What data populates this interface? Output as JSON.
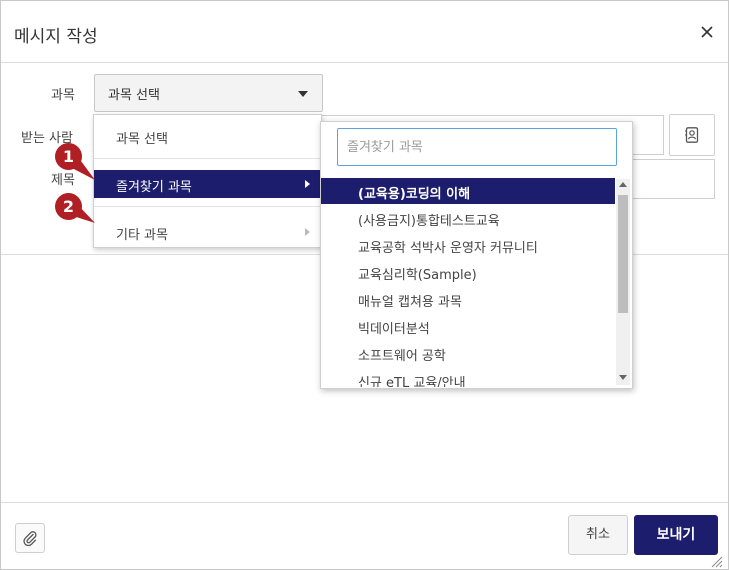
{
  "dialog": {
    "title": "메시지 작성"
  },
  "form": {
    "course_label": "과목",
    "recipient_label": "받는 사람",
    "subject_label": "제목",
    "course_select_value": "과목 선택"
  },
  "menu": {
    "items": [
      {
        "label": "과목 선택"
      },
      {
        "label": "즐겨찾기 과목"
      },
      {
        "label": "기타 과목"
      }
    ]
  },
  "submenu": {
    "search_placeholder": "즐겨찾기 과목",
    "items": [
      {
        "label": "(교육용)코딩의 이해"
      },
      {
        "label": "(사용금지)통합테스트교육"
      },
      {
        "label": "교육공학 석박사 운영자 커뮤니티"
      },
      {
        "label": "교육심리학(Sample)"
      },
      {
        "label": "매뉴얼 캡쳐용 과목"
      },
      {
        "label": "빅데이터분석"
      },
      {
        "label": "소프트웨어 공학"
      },
      {
        "label": "신규 eTL 교육/안내"
      }
    ]
  },
  "callouts": [
    {
      "number": "1"
    },
    {
      "number": "2"
    }
  ],
  "footer": {
    "cancel_label": "취소",
    "send_label": "보내기"
  },
  "colors": {
    "accent": "#1d1d6e",
    "callout": "#b01f24",
    "search_border": "#5ba3e0"
  },
  "icons": {
    "close": "close-icon",
    "address_book": "address-book-icon",
    "attach": "paperclip-icon",
    "dropdown": "caret-down-icon",
    "submenu": "caret-right-icon"
  }
}
